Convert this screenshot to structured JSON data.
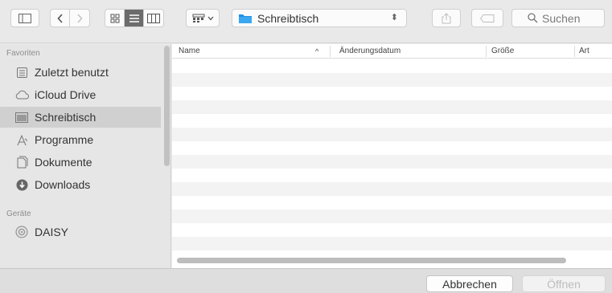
{
  "toolbar": {
    "location": "Schreibtisch",
    "search_placeholder": "Suchen"
  },
  "sidebar": {
    "favorites_title": "Favoriten",
    "favorites": [
      {
        "label": "Zuletzt benutzt",
        "icon": "recents-icon"
      },
      {
        "label": "iCloud Drive",
        "icon": "cloud-icon"
      },
      {
        "label": "Schreibtisch",
        "icon": "desktop-icon",
        "selected": true
      },
      {
        "label": "Programme",
        "icon": "applications-icon"
      },
      {
        "label": "Dokumente",
        "icon": "documents-icon"
      },
      {
        "label": "Downloads",
        "icon": "downloads-icon"
      }
    ],
    "devices_title": "Geräte",
    "devices": [
      {
        "label": "DAISY",
        "icon": "disk-icon"
      }
    ]
  },
  "filelist": {
    "columns": [
      {
        "label": "Name",
        "sort": "ascending"
      },
      {
        "label": "Änderungsdatum"
      },
      {
        "label": "Größe"
      },
      {
        "label": "Art"
      }
    ],
    "rows": []
  },
  "buttons": {
    "cancel": "Abbrechen",
    "open": "Öffnen"
  },
  "colors": {
    "selection": "#d0d0d0",
    "folder_blue": "#1e90e6",
    "active_segment": "#6c6c6c"
  }
}
